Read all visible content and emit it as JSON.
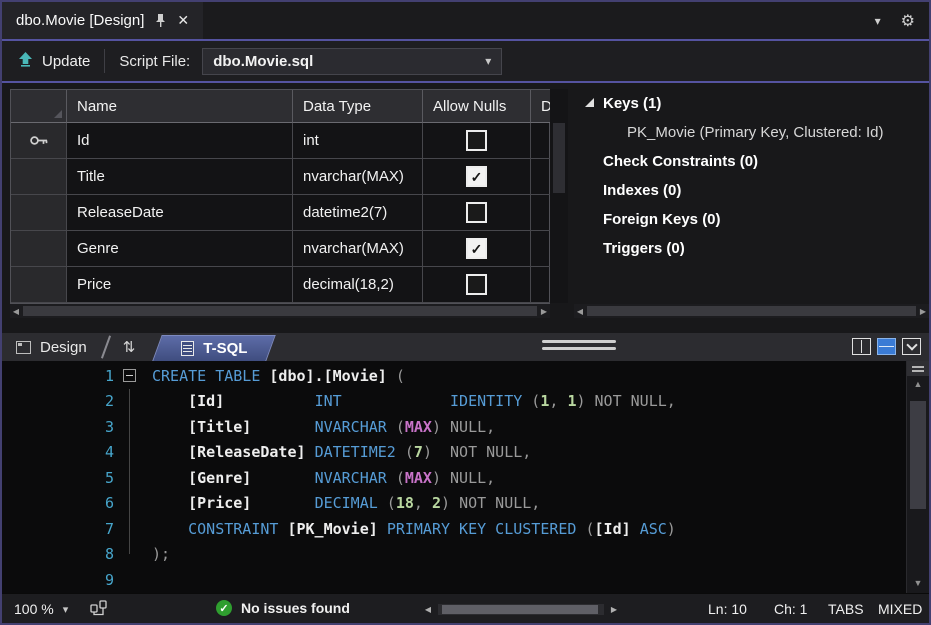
{
  "tabbar": {
    "title": "dbo.Movie [Design]"
  },
  "toolbar": {
    "update_label": "Update",
    "script_file_label": "Script File:",
    "script_file_value": "dbo.Movie.sql"
  },
  "grid": {
    "headers": [
      "Name",
      "Data Type",
      "Allow Nulls",
      "D"
    ],
    "rows": [
      {
        "name": "Id",
        "type": "int",
        "allow_nulls": false,
        "key": true
      },
      {
        "name": "Title",
        "type": "nvarchar(MAX)",
        "allow_nulls": true,
        "key": false
      },
      {
        "name": "ReleaseDate",
        "type": "datetime2(7)",
        "allow_nulls": false,
        "key": false
      },
      {
        "name": "Genre",
        "type": "nvarchar(MAX)",
        "allow_nulls": true,
        "key": false
      },
      {
        "name": "Price",
        "type": "decimal(18,2)",
        "allow_nulls": false,
        "key": false
      }
    ]
  },
  "keys_panel": {
    "items": [
      {
        "label": "Keys (1)",
        "bold": true,
        "expanded": true,
        "level": 0
      },
      {
        "label": "PK_Movie   (Primary Key, Clustered: Id)",
        "bold": false,
        "expanded": false,
        "level": 1
      },
      {
        "label": "Check Constraints (0)",
        "bold": true,
        "expanded": false,
        "level": 0
      },
      {
        "label": "Indexes (0)",
        "bold": true,
        "expanded": false,
        "level": 0
      },
      {
        "label": "Foreign Keys (0)",
        "bold": true,
        "expanded": false,
        "level": 0
      },
      {
        "label": "Triggers (0)",
        "bold": true,
        "expanded": false,
        "level": 0
      }
    ]
  },
  "pane_tabs": {
    "design_label": "Design",
    "tsql_label": "T-SQL"
  },
  "editor": {
    "lines": [
      {
        "n": "1",
        "fold": true,
        "segs": [
          [
            "kw",
            "CREATE TABLE"
          ],
          [
            "pl",
            " "
          ],
          [
            "id",
            "[dbo].[Movie]"
          ],
          [
            "pl",
            " ("
          ]
        ]
      },
      {
        "n": "2",
        "fold": false,
        "segs": [
          [
            "pl",
            "    "
          ],
          [
            "id",
            "[Id]"
          ],
          [
            "pl",
            "          "
          ],
          [
            "kw",
            "INT"
          ],
          [
            "pl",
            "            "
          ],
          [
            "kw",
            "IDENTITY"
          ],
          [
            "pl",
            " ("
          ],
          [
            "num",
            "1"
          ],
          [
            "pl",
            ", "
          ],
          [
            "num",
            "1"
          ],
          [
            "pl",
            ") "
          ],
          [
            "gr",
            "NOT NULL,"
          ]
        ]
      },
      {
        "n": "3",
        "fold": false,
        "segs": [
          [
            "pl",
            "    "
          ],
          [
            "id",
            "[Title]"
          ],
          [
            "pl",
            "       "
          ],
          [
            "kw",
            "NVARCHAR"
          ],
          [
            "pl",
            " ("
          ],
          [
            "mx",
            "MAX"
          ],
          [
            "pl",
            ") "
          ],
          [
            "gr",
            "NULL,"
          ]
        ]
      },
      {
        "n": "4",
        "fold": false,
        "segs": [
          [
            "pl",
            "    "
          ],
          [
            "id",
            "[ReleaseDate]"
          ],
          [
            "pl",
            " "
          ],
          [
            "kw",
            "DATETIME2"
          ],
          [
            "pl",
            " ("
          ],
          [
            "num",
            "7"
          ],
          [
            "pl",
            ")  "
          ],
          [
            "gr",
            "NOT NULL,"
          ]
        ]
      },
      {
        "n": "5",
        "fold": false,
        "segs": [
          [
            "pl",
            "    "
          ],
          [
            "id",
            "[Genre]"
          ],
          [
            "pl",
            "       "
          ],
          [
            "kw",
            "NVARCHAR"
          ],
          [
            "pl",
            " ("
          ],
          [
            "mx",
            "MAX"
          ],
          [
            "pl",
            ") "
          ],
          [
            "gr",
            "NULL,"
          ]
        ]
      },
      {
        "n": "6",
        "fold": false,
        "segs": [
          [
            "pl",
            "    "
          ],
          [
            "id",
            "[Price]"
          ],
          [
            "pl",
            "       "
          ],
          [
            "kw",
            "DECIMAL"
          ],
          [
            "pl",
            " ("
          ],
          [
            "num",
            "18"
          ],
          [
            "pl",
            ", "
          ],
          [
            "num",
            "2"
          ],
          [
            "pl",
            ") "
          ],
          [
            "gr",
            "NOT NULL,"
          ]
        ]
      },
      {
        "n": "7",
        "fold": false,
        "segs": [
          [
            "pl",
            "    "
          ],
          [
            "kw",
            "CONSTRAINT"
          ],
          [
            "pl",
            " "
          ],
          [
            "id",
            "[PK_Movie]"
          ],
          [
            "pl",
            " "
          ],
          [
            "kw",
            "PRIMARY KEY CLUSTERED"
          ],
          [
            "pl",
            " ("
          ],
          [
            "id",
            "[Id]"
          ],
          [
            "pl",
            " "
          ],
          [
            "kw",
            "ASC"
          ],
          [
            "pl",
            ")"
          ]
        ]
      },
      {
        "n": "8",
        "fold": false,
        "segs": [
          [
            "gr",
            ");"
          ]
        ]
      },
      {
        "n": "9",
        "fold": false,
        "segs": []
      }
    ]
  },
  "status": {
    "zoom": "100 %",
    "message": "No issues found",
    "ln": "Ln: 10",
    "ch": "Ch: 1",
    "tabs": "TABS",
    "mode": "MIXED"
  },
  "icons": {
    "close": "✕",
    "gear": "⚙",
    "chevron_down": "▾",
    "swap": "⇅",
    "checkmark": "✓",
    "scroll_up": "▲",
    "scroll_down": "▼",
    "scroll_left": "◀",
    "scroll_right": "▶"
  },
  "colors": {
    "accent_purple": "#5553a0",
    "keyword_blue": "#569cd6",
    "selected_tab_blue": "#4d5c96",
    "status_ok_green": "#2f9e2f",
    "line_number_teal": "#47a6cc",
    "max_magenta": "#c873c8"
  }
}
